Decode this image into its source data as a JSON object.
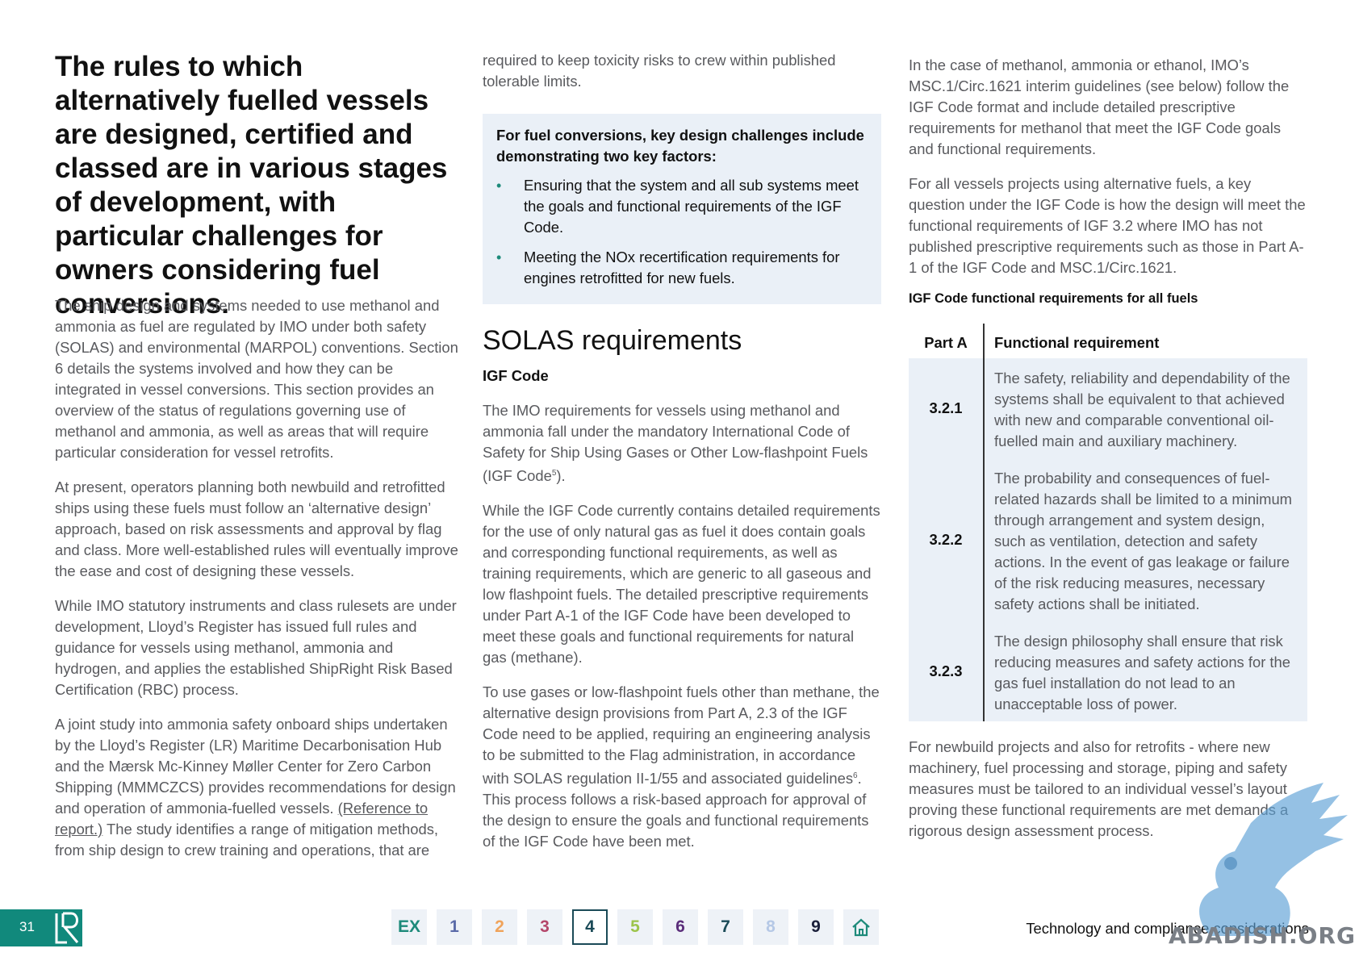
{
  "col1": {
    "heading": "The rules to which alternatively fuelled vessels are designed, certified and classed are in various stages of development, with particular challenges for owners considering fuel conversions.",
    "p1": "The ship design and systems needed to use methanol and ammonia as fuel are regulated by IMO under both safety (SOLAS) and environmental (MARPOL) conventions. Section 6 details the systems involved and how they can be integrated in vessel conversions. This section provides an overview of the status of regulations governing use of methanol and ammonia, as well as areas that will require particular consideration for vessel retrofits.",
    "p2": "At present, operators planning both newbuild and retrofitted ships using these fuels must follow an ‘alternative design’ approach, based on risk assessments and approval by flag and class. More well-established rules will eventually improve the ease and cost of designing these vessels.",
    "p3": "While IMO statutory instruments and class rulesets are under development, Lloyd’s Register has issued full rules and guidance for vessels using methanol, ammonia and hydrogen, and applies the established ShipRight Risk Based Certification (RBC) process.",
    "p4_a": "A joint study into ammonia safety onboard ships undertaken by the Lloyd’s Register (LR) Maritime Decarbonisation Hub and the Mærsk Mc-Kinney Møller Center for Zero Carbon Shipping (MMMCZCS) provides recommendations for design and operation of ammonia-fuelled vessels. ",
    "p4_link": "(Reference to report.)",
    "p4_b": " The study identifies a range of mitigation methods, from ship design to crew training and operations, that are"
  },
  "col2": {
    "top_text": "required to keep toxicity risks to crew within published tolerable limits.",
    "callout_title": "For fuel conversions, key design challenges include demonstrating two key factors:",
    "bullets": [
      "Ensuring that the system and all sub systems meet the goals and functional requirements of the IGF Code.",
      "Meeting the NOx recertification requirements for engines retrofitted for new fuels."
    ],
    "section_title": "SOLAS requirements",
    "subheading": "IGF Code",
    "p1_a": "The IMO requirements for vessels using methanol and ammonia fall under the mandatory International Code of Safety for Ship Using Gases or Other Low-flashpoint Fuels (IGF Code",
    "p1_sup": "5",
    "p1_b": ").",
    "p2": "While the IGF Code currently contains detailed requirements for the use of only natural gas as fuel it does contain goals and corresponding functional requirements, as well as training requirements, which are generic to all gaseous and low flashpoint fuels. The detailed prescriptive requirements under Part A-1 of the IGF Code have been developed to meet these goals and functional requirements for natural gas (methane).",
    "p3_a": "To use gases or low-flashpoint fuels other than methane, the alternative design provisions from Part A, 2.3 of the IGF Code need to be applied, requiring an engineering analysis to be submitted to the Flag administration, in accordance with SOLAS regulation II-1/55 and associated guidelines",
    "p3_sup": "6",
    "p3_b": ". This process follows a risk-based approach for approval of the design to ensure the goals and functional requirements of the IGF Code have been met."
  },
  "col3": {
    "p1": "In the case of methanol, ammonia or ethanol, IMO’s MSC.1/Circ.1621 interim guidelines (see below) follow the IGF Code format and include detailed prescriptive requirements for methanol that meet the IGF Code goals and functional requirements.",
    "p2": "For all vessels projects using alternative fuels, a key question under the IGF Code is how the design will meet the functional requirements of IGF 3.2 where IMO has not published prescriptive requirements such as those in Part A-1 of the IGF Code and MSC.1/Circ.1621.",
    "table_caption": "IGF Code functional requirements for all fuels",
    "table": {
      "headers": [
        "Part A",
        "Functional requirement"
      ],
      "rows": [
        {
          "part": "3.2.1",
          "req": "The safety, reliability and dependability of the systems shall be equivalent to that achieved with new and comparable conventional oil-fuelled main and auxiliary machinery."
        },
        {
          "part": "3.2.2",
          "req": "The probability and consequences of fuel-related hazards shall be limited to a minimum through arrangement and system design, such as ventilation, detection and safety actions. In the event of gas leakage or failure of the risk reducing measures, necessary safety actions shall be initiated."
        },
        {
          "part": "3.2.3",
          "req": "The design philosophy shall ensure that risk reducing measures and safety actions for the gas fuel installation do not lead to an unacceptable loss of power."
        }
      ]
    },
    "p3": "For newbuild projects and also for retrofits - where new machinery, fuel processing and storage, piping and safety measures must be tailored to an individual vessel’s layout proving these functional requirements are met demands a rigorous design assessment process."
  },
  "footer": {
    "page_number": "31",
    "section_title": "Technology and compliance considerations",
    "nav": [
      {
        "label": "EX",
        "color": "#1d8a7a"
      },
      {
        "label": "1",
        "color": "#5a6aa8"
      },
      {
        "label": "2",
        "color": "#f0a35a"
      },
      {
        "label": "3",
        "color": "#b4466a"
      },
      {
        "label": "4",
        "color": "#1a4a57"
      },
      {
        "label": "5",
        "color": "#9cc44a"
      },
      {
        "label": "6",
        "color": "#5a2d7a"
      },
      {
        "label": "7",
        "color": "#1a4a57"
      },
      {
        "label": "8",
        "color": "#b5c8e6"
      },
      {
        "label": "9",
        "color": "#1a1f3a"
      }
    ],
    "home_icon": "home-icon",
    "active_section": "4"
  },
  "watermark_text": "ABADISH.ORG"
}
